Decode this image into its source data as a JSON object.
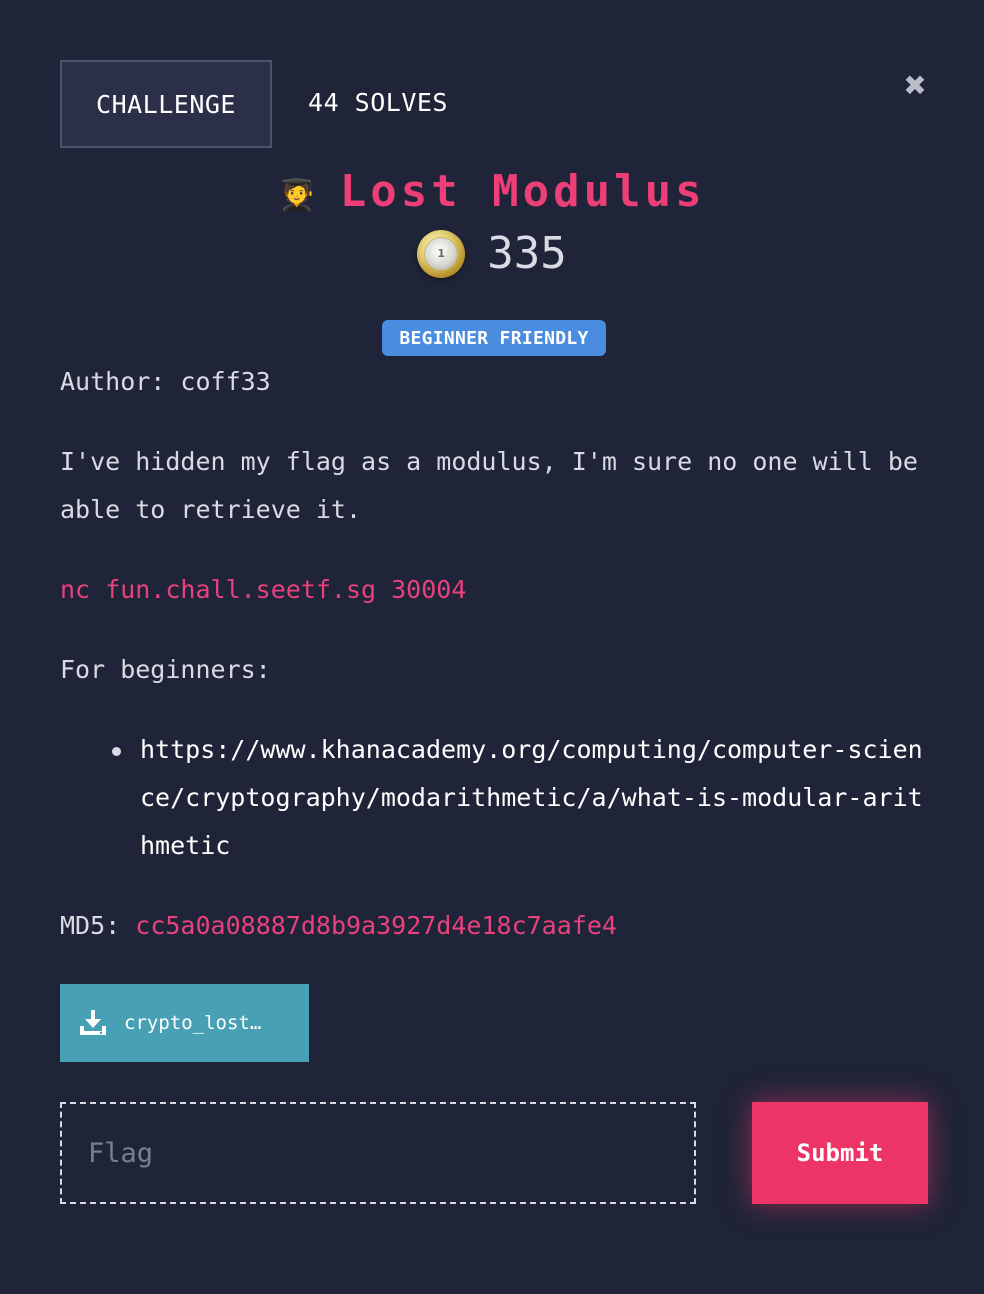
{
  "tabs": [
    {
      "label": "CHALLENGE",
      "active": true
    },
    {
      "label": "44 SOLVES",
      "active": false
    }
  ],
  "close_icon": "close-icon",
  "challenge": {
    "emoji": "🧑‍🎓",
    "title": "Lost Modulus",
    "coin_icon": "coin-icon",
    "coin_text": "1",
    "points": "335",
    "badge": "BEGINNER FRIENDLY"
  },
  "description": {
    "author_label": "Author:",
    "author": "coff33",
    "intro": "I've hidden my flag as a modulus, I'm sure no one will be able to retrieve it.",
    "connection": "nc fun.chall.seetf.sg 30004",
    "beginners_label": "For beginners:",
    "links": [
      "https://www.khanacademy.org/computing/computer-science/cryptography/modarithmetic/a/what-is-modular-arithmetic"
    ],
    "md5_label": "MD5:",
    "md5": "cc5a0a08887d8b9a3927d4e18c7aafe4"
  },
  "download": {
    "icon": "download-icon",
    "label": "crypto_lost…"
  },
  "flag_form": {
    "placeholder": "Flag",
    "value": "",
    "submit_label": "Submit"
  },
  "colors": {
    "background": "#1f2438",
    "accent": "#ec3f77",
    "badge": "#4a8de0",
    "download": "#47a0b4",
    "submit": "#ec3467"
  }
}
